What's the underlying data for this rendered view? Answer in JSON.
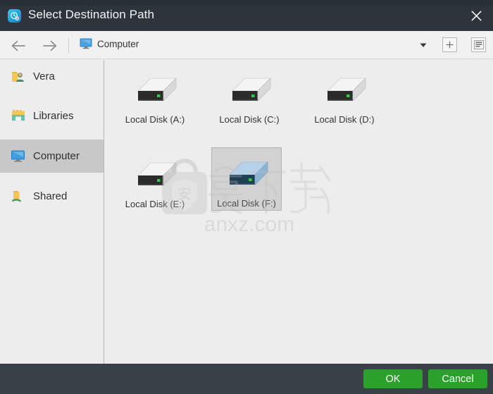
{
  "window": {
    "title": "Select Destination Path",
    "app_icon": "clock-gear-icon",
    "close_icon": "close-icon"
  },
  "toolbar": {
    "back_icon": "arrow-left-icon",
    "forward_icon": "arrow-right-icon",
    "breadcrumb_icon": "computer-monitor-icon",
    "breadcrumb_label": "Computer",
    "dropdown_icon": "chevron-down-icon",
    "add_icon": "plus-icon",
    "view_icon": "list-view-icon"
  },
  "sidebar": {
    "items": [
      {
        "label": "Vera",
        "icon": "user-folder-icon",
        "selected": false
      },
      {
        "label": "Libraries",
        "icon": "libraries-icon",
        "selected": false
      },
      {
        "label": "Computer",
        "icon": "computer-monitor-icon",
        "selected": true
      },
      {
        "label": "Shared",
        "icon": "shared-folder-icon",
        "selected": false
      }
    ]
  },
  "content": {
    "drives": [
      {
        "label": "Local Disk (A:)",
        "selected": false
      },
      {
        "label": "Local Disk (C:)",
        "selected": false
      },
      {
        "label": "Local Disk (D:)",
        "selected": false
      },
      {
        "label": "Local Disk (E:)",
        "selected": false
      },
      {
        "label": "Local Disk (F:)",
        "selected": true
      }
    ]
  },
  "watermark": {
    "text": "anxz.com",
    "logo_char": "安"
  },
  "footer": {
    "ok_label": "OK",
    "cancel_label": "Cancel"
  },
  "colors": {
    "titlebar": "#2e343c",
    "footer": "#3a4048",
    "accent_green": "#2ba02b",
    "accent_blue": "#1a9fd4",
    "selection_gray": "#c9c8c9"
  }
}
